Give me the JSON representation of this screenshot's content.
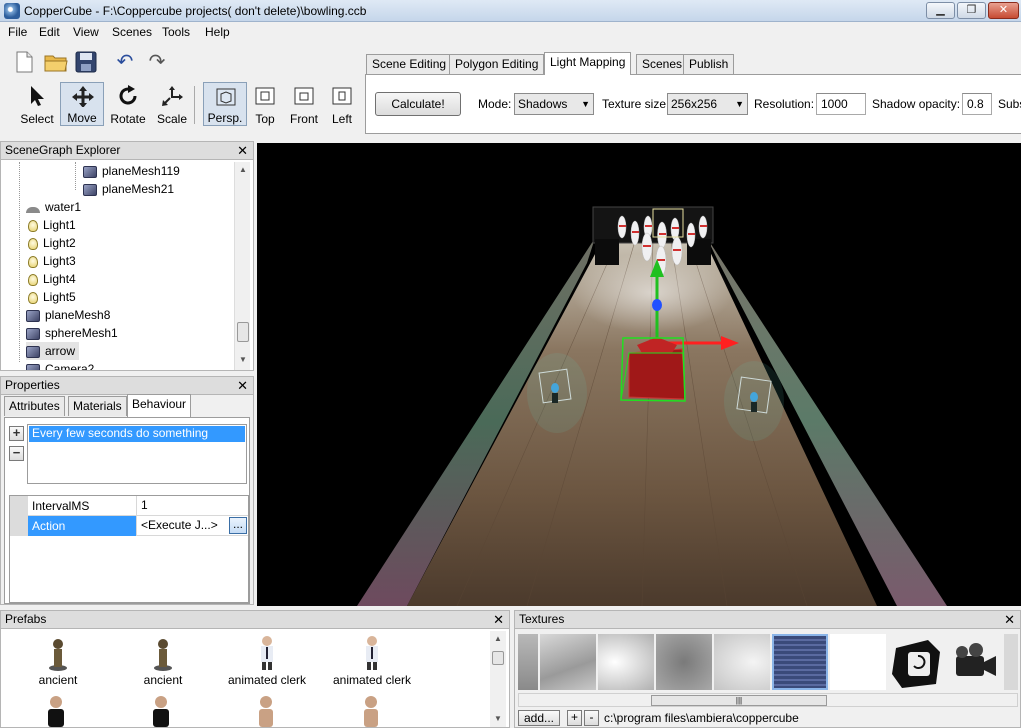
{
  "window": {
    "title": "CopperCube - F:\\Coppercube projects( don't delete)\\bowling.ccb",
    "min_icon": "minimize-icon",
    "max_icon": "maximize-icon",
    "close_icon": "close-icon",
    "min": "▁",
    "max": "❐",
    "close": "✕"
  },
  "menu": [
    "File",
    "Edit",
    "View",
    "Scenes",
    "Tools",
    "Help"
  ],
  "toolbar": {
    "file_buttons": [
      {
        "name": "new-file-icon",
        "glyph": "🗋"
      },
      {
        "name": "open-folder-icon",
        "glyph": "📂"
      },
      {
        "name": "save-disk-icon",
        "glyph": "💾"
      }
    ],
    "undo_glyph": "↶",
    "redo_glyph": "↷",
    "tools": [
      {
        "label": "Select",
        "glyph": "➤"
      },
      {
        "label": "Move",
        "glyph": "✥"
      },
      {
        "label": "Rotate",
        "glyph": "↻"
      },
      {
        "label": "Scale",
        "glyph": "⤡"
      }
    ],
    "views": [
      {
        "label": "Persp.",
        "glyph": "⬚"
      },
      {
        "label": "Top",
        "glyph": "⬚"
      },
      {
        "label": "Front",
        "glyph": "⬚"
      },
      {
        "label": "Left",
        "glyph": "⬚"
      }
    ]
  },
  "tabs": [
    "Scene Editing",
    "Polygon Editing",
    "Light Mapping",
    "Scenes",
    "Publish"
  ],
  "active_tab": "Light Mapping",
  "ribbon": {
    "calculate": "Calculate!",
    "mode_label": "Mode:",
    "mode_value": "Shadows",
    "texture_size_label": "Texture size:",
    "texture_size_value": "256x256",
    "resolution_label": "Resolution:",
    "resolution_value": "1000",
    "shadow_opacity_label": "Shadow opacity:",
    "shadow_opacity_value": "0.8",
    "subs_label": "Subs"
  },
  "scenegraph": {
    "title": "SceneGraph Explorer",
    "close": "✕",
    "items": [
      {
        "label": "planeMesh119",
        "icon": "cube-icon"
      },
      {
        "label": "planeMesh21",
        "icon": "cube-icon"
      },
      {
        "label": "water1",
        "icon": "water-icon"
      },
      {
        "label": "Light1",
        "icon": "light-bulb-icon"
      },
      {
        "label": "Light2",
        "icon": "light-bulb-icon"
      },
      {
        "label": "Light3",
        "icon": "light-bulb-icon"
      },
      {
        "label": "Light4",
        "icon": "light-bulb-icon"
      },
      {
        "label": "Light5",
        "icon": "light-bulb-icon"
      },
      {
        "label": "planeMesh8",
        "icon": "cube-icon"
      },
      {
        "label": "sphereMesh1",
        "icon": "cube-icon"
      },
      {
        "label": "arrow",
        "icon": "cube-icon"
      },
      {
        "label": "Camera2",
        "icon": "camera-icon"
      }
    ]
  },
  "properties": {
    "title": "Properties",
    "close": "✕",
    "tabs": [
      "Attributes",
      "Materials",
      "Behaviour"
    ],
    "active_tab": "Behaviour",
    "behaviours": [
      "Every few seconds do something"
    ],
    "add": "+",
    "remove": "−",
    "rows": [
      {
        "name": "IntervalMS",
        "value": "1"
      },
      {
        "name": "Action",
        "value": "<Execute J...>"
      }
    ],
    "edit_button": "..."
  },
  "prefabs": {
    "title": "Prefabs",
    "close": "✕",
    "items": [
      "ancient",
      "ancient",
      "animated clerk",
      "animated clerk"
    ]
  },
  "textures": {
    "title": "Textures",
    "close": "✕",
    "add": "add...",
    "plus": "+",
    "minus": "-",
    "path": "c:\\program files\\ambiera\\coppercube",
    "scroll_grip": "|||"
  },
  "colors": {
    "selection": "#3399ff",
    "gizmo_x": "#ff2020",
    "gizmo_y": "#20c020",
    "gizmo_z": "#2050ff",
    "selection_box": "#20e020"
  }
}
